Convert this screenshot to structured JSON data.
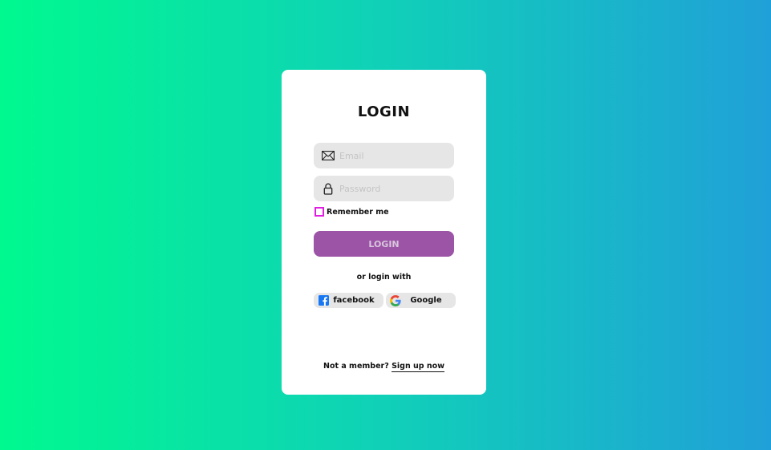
{
  "login_card": {
    "title": "LOGIN",
    "email_placeholder": "Email",
    "password_placeholder": "Password",
    "remember_label": "Remember me",
    "login_button_label": "LOGIN",
    "or_text": "or login with",
    "facebook_label": "facebook",
    "google_label": "Google",
    "footer_text": "Not a member?",
    "signup_link": "Sign up now"
  },
  "colors": {
    "gradient_start": "#00f98f",
    "gradient_end": "#20a0d8",
    "card_bg": "#ffffff",
    "field_bg": "#e6e6e6",
    "login_button": "#9c54a6",
    "checkbox_border": "#e020e0"
  },
  "icons": {
    "email": "envelope-icon",
    "password": "lock-icon",
    "facebook": "facebook-icon",
    "google": "google-icon"
  }
}
